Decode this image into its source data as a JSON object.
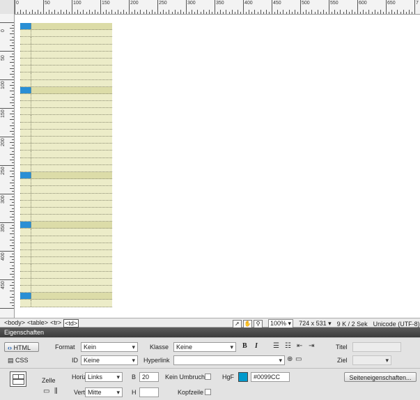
{
  "ruler": {
    "h_labels": [
      "0",
      "50",
      "100",
      "150",
      "200",
      "250",
      "300",
      "350",
      "400",
      "450",
      "500",
      "550",
      "600",
      "650",
      "7"
    ],
    "v_labels": [
      "0",
      "50",
      "100",
      "150",
      "200",
      "250",
      "300",
      "350",
      "400",
      "450"
    ]
  },
  "table_rows": [
    true,
    false,
    false,
    false,
    false,
    false,
    false,
    false,
    false,
    true,
    false,
    false,
    false,
    false,
    false,
    false,
    false,
    false,
    false,
    false,
    false,
    true,
    false,
    false,
    false,
    false,
    false,
    false,
    true,
    false,
    false,
    false,
    false,
    false,
    false,
    false,
    false,
    false,
    true,
    false
  ],
  "tag_path": [
    "<body>",
    "<table>",
    "<tr>",
    "<td>"
  ],
  "status": {
    "zoom": "100%",
    "dimensions": "724 x 531",
    "size": "9 K / 2 Sek",
    "encoding": "Unicode (UTF-8)"
  },
  "properties": {
    "panel_title": "Eigenschaften",
    "html_button": "HTML",
    "css_button": "CSS",
    "format_label": "Format",
    "format_value": "Kein",
    "id_label": "ID",
    "id_value": "Keine",
    "class_label": "Klasse",
    "class_value": "Keine",
    "hyperlink_label": "Hyperlink",
    "hyperlink_value": "",
    "bold_label": "B",
    "italic_label": "I",
    "title_label": "Titel",
    "target_label": "Ziel",
    "cell_label": "Zelle",
    "horiz_label": "Horiz",
    "horiz_value": "Links",
    "vert_label": "Vert",
    "vert_value": "Mitte",
    "width_label": "B",
    "width_value": "20",
    "height_label": "H",
    "height_value": "",
    "nowrap_label": "Kein Umbruch",
    "header_label": "Kopfzeile",
    "bg_label": "HgF",
    "bg_value": "#0099CC",
    "page_props_button": "Seiteneigenschaften..."
  },
  "colors": {
    "cell_accent": "#0099CC",
    "table_fill": "#ECECC8"
  }
}
